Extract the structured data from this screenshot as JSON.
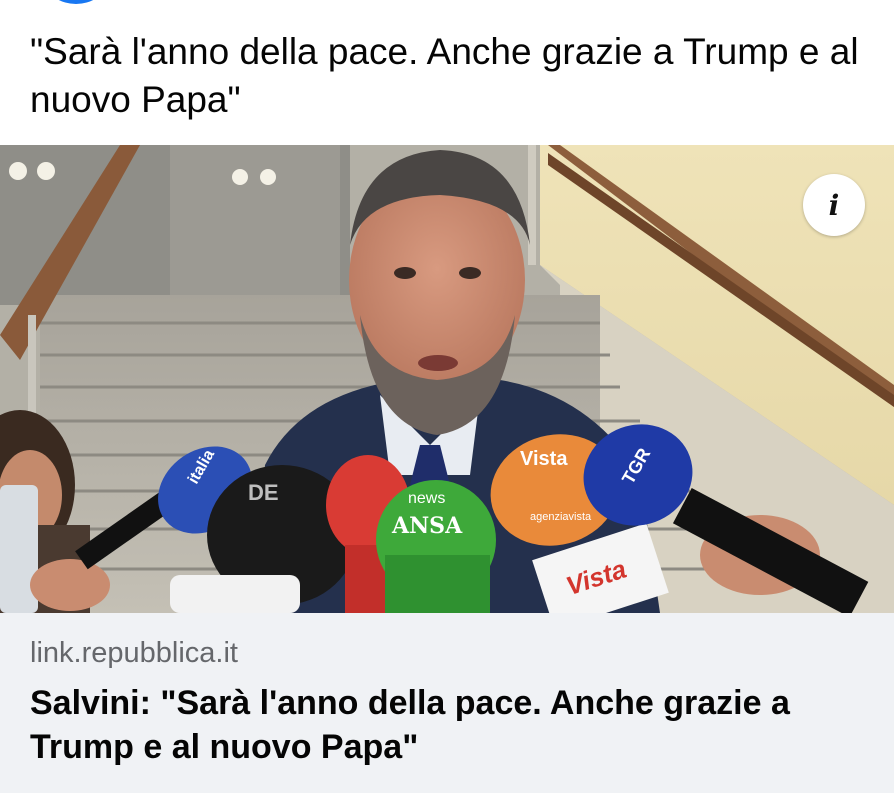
{
  "post": {
    "text": "\"Sarà l'anno della pace. Anche grazie a Trump e al nuovo Papa\""
  },
  "link_card": {
    "domain": "link.repubblica.it",
    "title": "Salvini: \"Sarà l'anno della pace. Anche grazie a Trump e al nuovo Papa\""
  },
  "image": {
    "info_icon": "info-icon",
    "info_glyph": "i",
    "mic_labels": {
      "ansa": "ANSA",
      "vista": "Vista",
      "tgr": "TGR",
      "news": "news",
      "agenzia": "agenziavista",
      "italia": "italia",
      "de": "DE"
    }
  },
  "colors": {
    "text_primary": "#050505",
    "text_secondary": "#65676b",
    "card_background": "#f0f2f5",
    "brand_blue": "#1877f2"
  }
}
